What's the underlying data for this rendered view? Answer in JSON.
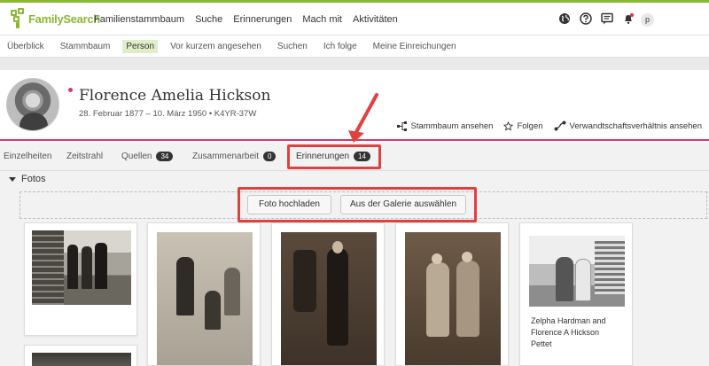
{
  "app": {
    "brand": "FamilySearch",
    "nav": [
      "Familienstammbaum",
      "Suche",
      "Erinnerungen",
      "Mach mit",
      "Aktivitäten"
    ],
    "user_initial": "p",
    "colors": {
      "brand_green": "#8ab833",
      "accent_pink": "#d53a6a",
      "highlight_red": "#e0413f"
    },
    "icons": [
      "globe-icon",
      "help-icon",
      "messages-icon",
      "notifications-icon"
    ]
  },
  "subnav": {
    "items": [
      "Überblick",
      "Stammbaum",
      "Person",
      "Vor kurzem angesehen",
      "Suchen",
      "Ich folge",
      "Meine Einreichungen"
    ],
    "active": "Person"
  },
  "person": {
    "name": "Florence Amelia Hickson",
    "dates_id": "28. Februar 1877 – 10. März 1950 • K4YR-37W",
    "actions": [
      "Stammbaum ansehen",
      "Folgen",
      "Verwandtschaftsverhältnis ansehen"
    ]
  },
  "tabs": [
    {
      "label": "Einzelheiten"
    },
    {
      "label": "Zeitstrahl"
    },
    {
      "label": "Quellen",
      "count": "34"
    },
    {
      "label": "Zusammenarbeit",
      "count": "0"
    },
    {
      "label": "Erinnerungen",
      "count": "14"
    }
  ],
  "fotos": {
    "title": "Fotos",
    "upload_button": "Foto hochladen",
    "gallery_button": "Aus der Galerie auswählen",
    "card_caption": "Zelpha Hardman and Florence A Hickson Pettet"
  }
}
